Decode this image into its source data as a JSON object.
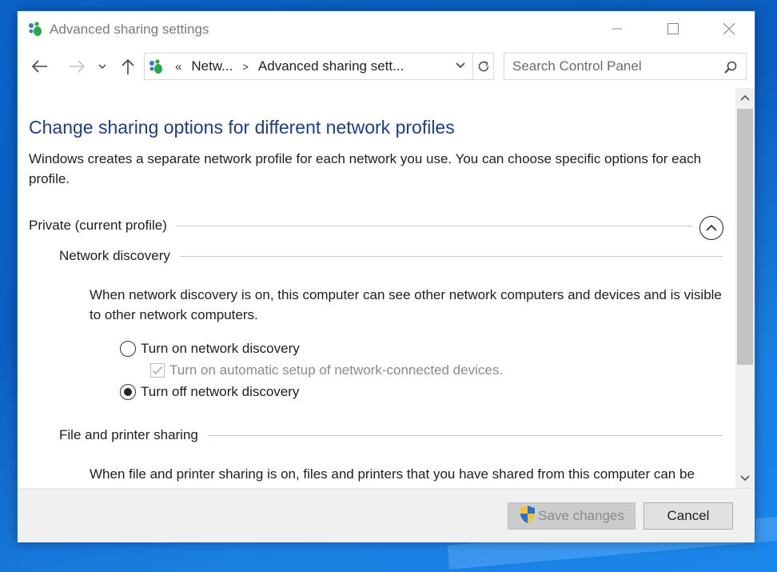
{
  "window": {
    "title": "Advanced sharing settings"
  },
  "nav": {
    "address": {
      "overflow": "«",
      "crumb1": "Netw...",
      "separator": ">",
      "crumb2": "Advanced sharing sett..."
    },
    "search": {
      "placeholder": "Search Control Panel",
      "value": ""
    }
  },
  "main": {
    "heading": "Change sharing options for different network profiles",
    "description": "Windows creates a separate network profile for each network you use. You can choose specific options for each profile.",
    "profile": {
      "label": "Private (current profile)"
    },
    "network_discovery": {
      "label": "Network discovery",
      "description": "When network discovery is on, this computer can see other network computers and devices and is visible to other network computers.",
      "option_on": "Turn on network discovery",
      "option_auto": "Turn on automatic setup of network-connected devices.",
      "option_off": "Turn off network discovery",
      "selected": "off",
      "auto_checked": true,
      "auto_enabled": false
    },
    "file_printer": {
      "label": "File and printer sharing",
      "description": "When file and printer sharing is on, files and printers that you have shared from this computer can be accessed by people on the network."
    }
  },
  "footer": {
    "save_label": "Save changes",
    "cancel_label": "Cancel"
  },
  "colors": {
    "heading": "#1c3d8f",
    "disabled_text": "#8a8a8a"
  }
}
